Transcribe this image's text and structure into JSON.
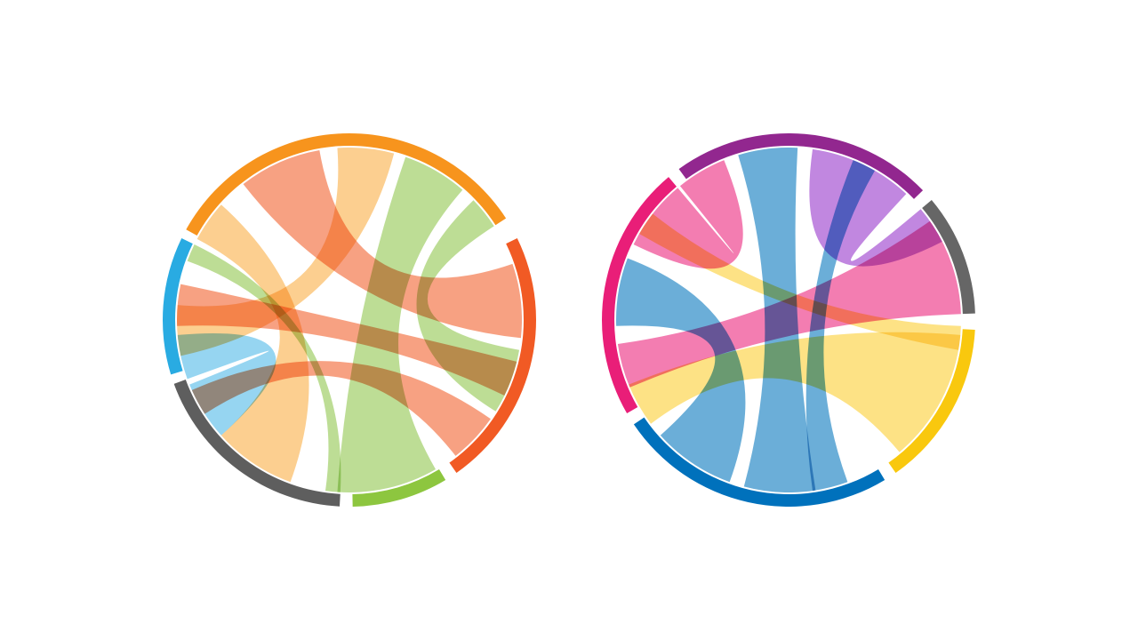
{
  "diagrams": [
    {
      "name": "left-chord-diagram",
      "groups": [
        {
          "id": "orange",
          "color": "#F7941D",
          "ribbon_color": "#FBC577",
          "start": 299,
          "end": 57
        },
        {
          "id": "red-orange",
          "color": "#F15A24",
          "ribbon_color": "#F58C66",
          "start": 64,
          "end": 145
        },
        {
          "id": "green",
          "color": "#8DC63F",
          "ribbon_color": "#AED67E",
          "start": 149,
          "end": 179
        },
        {
          "id": "dark-gray",
          "color": "#5E5E5E",
          "ribbon_color": "#9A9A9A",
          "start": 183,
          "end": 250
        },
        {
          "id": "blue",
          "color": "#29ABE2",
          "ribbon_color": "#7FCCEE",
          "start": 253,
          "end": 296
        }
      ],
      "ribbons": [
        {
          "color": "#FBC577",
          "a": [
            298,
            312
          ],
          "b": [
            200,
            228
          ]
        },
        {
          "color": "#F58C66",
          "a": [
            322,
            350
          ],
          "b": [
            71,
            96
          ]
        },
        {
          "color": "#FBC577",
          "a": [
            356,
            15
          ],
          "b": [
            258,
            275
          ]
        },
        {
          "color": "#AED67E",
          "a": [
            19,
            41
          ],
          "b": [
            150,
            184
          ]
        },
        {
          "color": "#AED67E",
          "a": [
            46,
            57
          ],
          "b": [
            100,
            122
          ]
        },
        {
          "color": "#F58C66",
          "a": [
            268,
            282
          ],
          "b": [
            104,
            116
          ]
        },
        {
          "color": "#7FCCEE",
          "a": [
            228,
            248
          ],
          "b": [
            250,
            265
          ]
        },
        {
          "color": "#F58C66",
          "a": [
            237,
            246
          ],
          "b": [
            125,
            142
          ]
        },
        {
          "color": "#AED67E",
          "a": [
            290,
            296
          ],
          "b": [
            183,
            188
          ]
        }
      ]
    },
    {
      "name": "right-chord-diagram",
      "groups": [
        {
          "id": "purple",
          "color": "#92278F",
          "ribbon_color": "#B36CD9",
          "start": 324,
          "end": 46
        },
        {
          "id": "gray",
          "color": "#666666",
          "ribbon_color": "#9A9A9A",
          "start": 50,
          "end": 88
        },
        {
          "id": "yellow",
          "color": "#F9C80E",
          "ribbon_color": "#FCDC6A",
          "start": 93,
          "end": 145
        },
        {
          "id": "blue",
          "color": "#0071BC",
          "ribbon_color": "#4A9CD0",
          "start": 149,
          "end": 236
        },
        {
          "id": "magenta",
          "color": "#E91E78",
          "ribbon_color": "#F060A0",
          "start": 240,
          "end": 320
        }
      ],
      "ribbons": [
        {
          "color": "#4A9CD0",
          "a": [
            343,
            3
          ],
          "b": [
            171,
            195
          ]
        },
        {
          "color": "#F060A0",
          "a": [
            247,
            262
          ],
          "b": [
            55,
            88
          ]
        },
        {
          "color": "#FCDC6A",
          "a": [
            233,
            248
          ],
          "b": [
            95,
            140
          ]
        },
        {
          "color": "#4A9CD0",
          "a": [
            268,
            291
          ],
          "b": [
            200,
            228
          ]
        },
        {
          "color": "#B36CD9",
          "a": [
            8,
            43
          ],
          "b": [
            50,
            63
          ]
        },
        {
          "color": "#F060A0",
          "a": [
            296,
            320
          ],
          "b": [
            321,
            338
          ]
        },
        {
          "color": "#FCDC6A",
          "a": [
            300,
            308
          ],
          "b": [
            92,
            100
          ]
        },
        {
          "color": "#4A9CD0",
          "a": [
            22,
            30
          ],
          "b": [
            160,
            172
          ]
        }
      ]
    }
  ]
}
